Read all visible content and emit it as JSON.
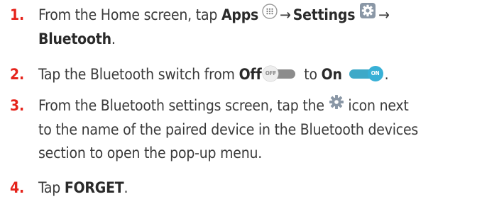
{
  "steps": [
    {
      "number": "1.",
      "text_a": "From the Home screen, tap ",
      "bold_a": "Apps",
      "arrow_a": "→",
      "bold_b": "Settings",
      "arrow_b": "→",
      "bold_c": "Bluetooth",
      "tail": "."
    },
    {
      "number": "2.",
      "text_a": "Tap the Bluetooth switch from ",
      "bold_a": "Off",
      "off_toggle_label": "OFF",
      "text_b": " to ",
      "bold_b": "On",
      "on_toggle_label": "ON",
      "tail": "."
    },
    {
      "number": "3.",
      "text_a": "From the Bluetooth settings screen, tap the ",
      "text_b": " icon next",
      "line2": "to the name of the paired device in the Bluetooth devices",
      "line3": "section to open the pop-up menu."
    },
    {
      "number": "4.",
      "text_a": "Tap ",
      "bold_a": "FORGET",
      "tail": "."
    }
  ],
  "icons": {
    "apps": "apps-grid-icon",
    "settings": "settings-gear-icon",
    "gear": "gear-icon"
  },
  "colors": {
    "step_number": "#e5231b",
    "toggle_on": "#38b0d6",
    "toggle_off": "#8c8c8c"
  }
}
